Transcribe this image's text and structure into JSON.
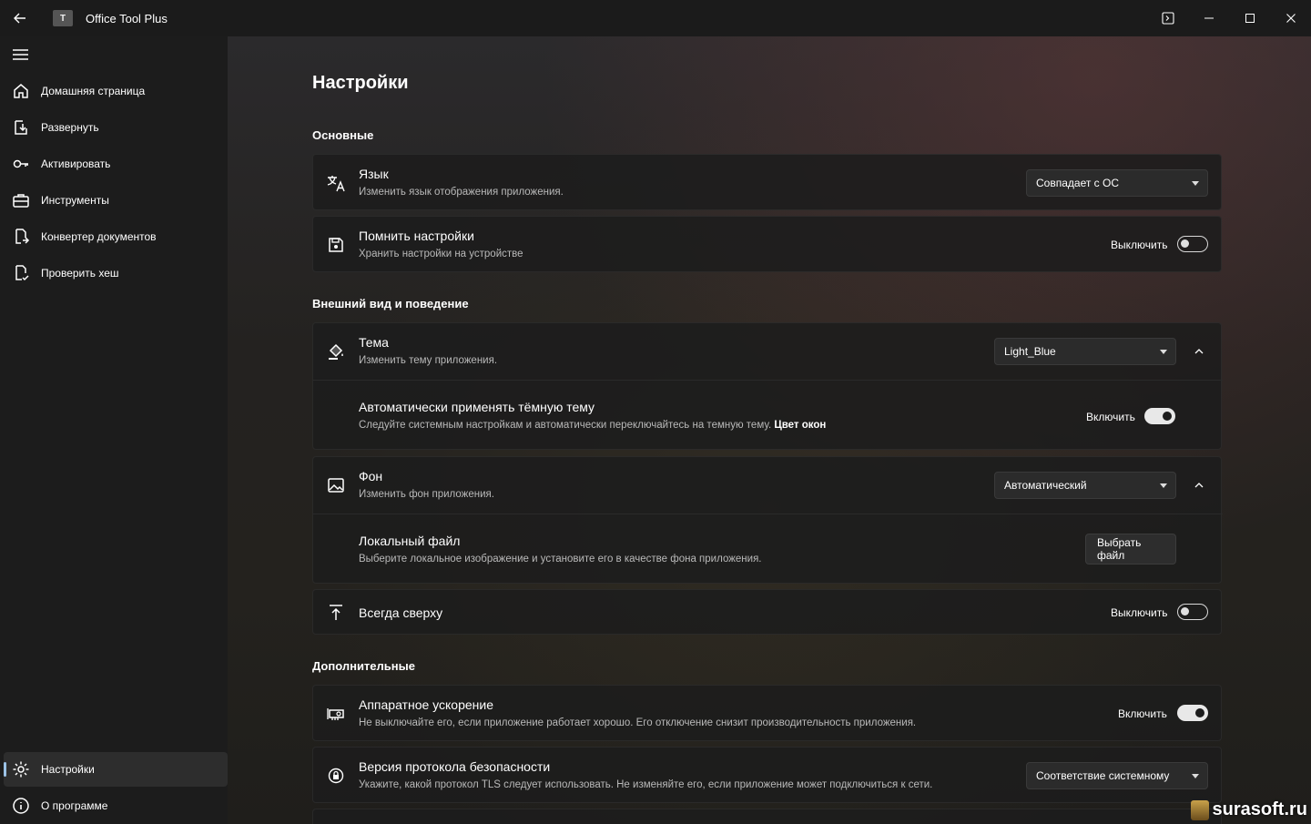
{
  "window": {
    "title": "Office Tool Plus",
    "logo_text": "T"
  },
  "sidebar": {
    "items": [
      {
        "label": "Домашняя страница",
        "icon": "home-icon"
      },
      {
        "label": "Развернуть",
        "icon": "deploy-icon"
      },
      {
        "label": "Активировать",
        "icon": "key-icon"
      },
      {
        "label": "Инструменты",
        "icon": "toolbox-icon"
      },
      {
        "label": "Конвертер документов",
        "icon": "convert-icon"
      },
      {
        "label": "Проверить хеш",
        "icon": "hash-check-icon"
      }
    ],
    "bottom_items": [
      {
        "label": "Настройки",
        "icon": "gear-icon",
        "active": true
      },
      {
        "label": "О программе",
        "icon": "info-icon"
      }
    ]
  },
  "page": {
    "title": "Настройки",
    "sections": {
      "basic": "Основные",
      "appearance": "Внешний вид и поведение",
      "advanced": "Дополнительные"
    }
  },
  "settings": {
    "language": {
      "title": "Язык",
      "desc": "Изменить язык отображения приложения.",
      "value": "Совпадает с ОС"
    },
    "remember": {
      "title": "Помнить настройки",
      "desc": "Хранить настройки на устройстве",
      "state_label": "Выключить",
      "on": false
    },
    "theme": {
      "title": "Тема",
      "desc": "Изменить тему приложения.",
      "value": "Light_Blue"
    },
    "auto_dark": {
      "title": "Автоматически применять тёмную тему",
      "desc": "Следуйте системным настройкам и автоматически переключайтесь на темную тему.",
      "desc_link": "Цвет окон",
      "state_label": "Включить",
      "on": true
    },
    "background": {
      "title": "Фон",
      "desc": "Изменить фон приложения.",
      "value": "Автоматический"
    },
    "local_file": {
      "title": "Локальный файл",
      "desc": "Выберите локальное изображение и установите его в качестве фона приложения.",
      "button": "Выбрать файл"
    },
    "always_on_top": {
      "title": "Всегда сверху",
      "state_label": "Выключить",
      "on": false
    },
    "hw_accel": {
      "title": "Аппаратное ускорение",
      "desc": "Не выключайте его, если приложение работает хорошо. Его отключение снизит производительность приложения.",
      "state_label": "Включить",
      "on": true
    },
    "tls": {
      "title": "Версия протокола безопасности",
      "desc": "Укажите, какой протокол TLS следует использовать. Не изменяйте его, если приложение может подключиться к сети.",
      "value": "Соответствие системному"
    }
  },
  "watermark": "surasoft.ru",
  "colors": {
    "accent": "#9cc3e6",
    "card_bg": "#1c1c1c"
  }
}
